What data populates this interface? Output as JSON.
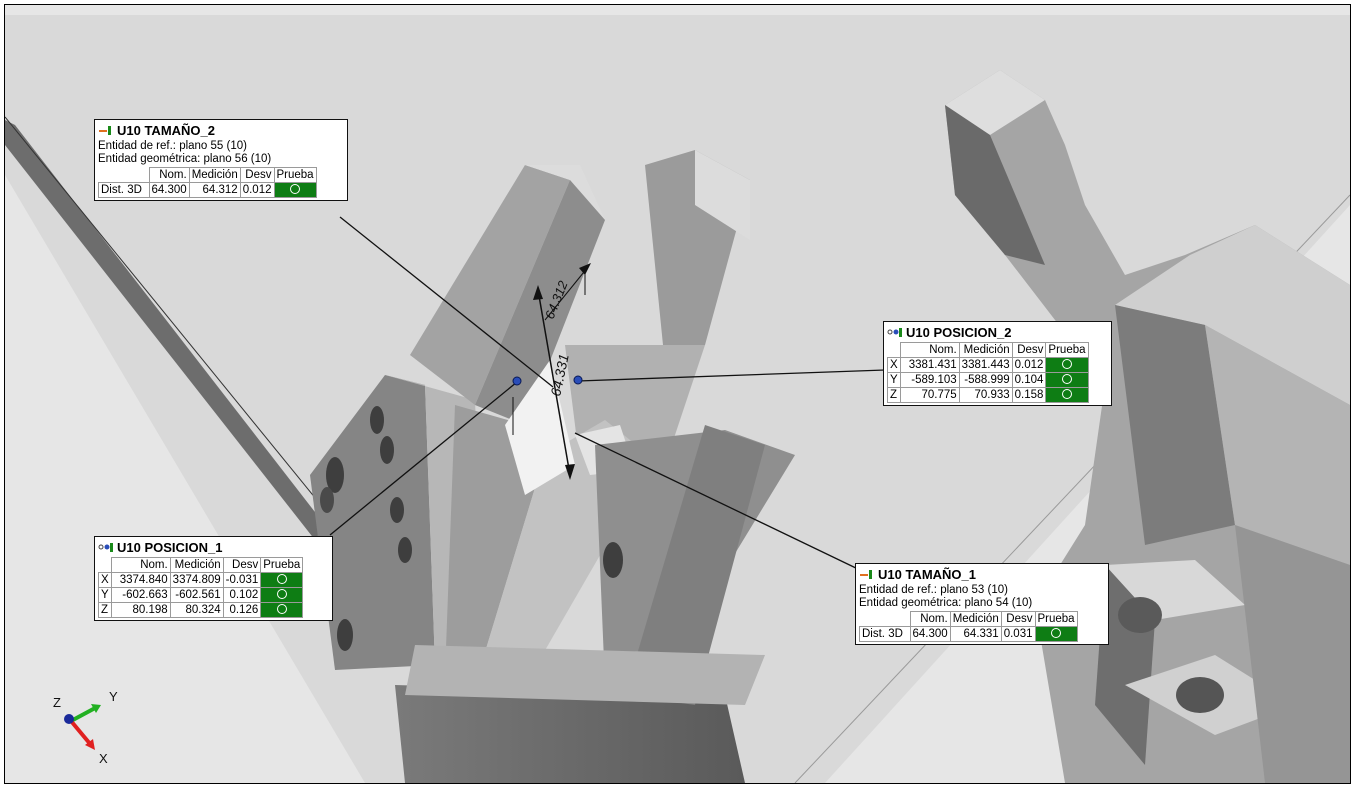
{
  "triad": {
    "x_label": "X",
    "y_label": "Y",
    "z_label": "Z"
  },
  "dimension_labels": {
    "d1": "64.331",
    "d2": "64.312"
  },
  "callouts": {
    "tamano2": {
      "title": "U10 TAMAÑO_2",
      "icon": "size-dimension-icon",
      "ref_line": "Entidad de ref.: plano 55 (10)",
      "geo_line": "Entidad geométrica: plano 56 (10)",
      "headers": [
        "Nom.",
        "Medición",
        "Desv",
        "Prueba"
      ],
      "row": {
        "label": "Dist. 3D",
        "nom": "64.300",
        "med": "64.312",
        "desv": "0.012"
      }
    },
    "tamano1": {
      "title": "U10 TAMAÑO_1",
      "icon": "size-dimension-icon",
      "ref_line": "Entidad de ref.: plano 53 (10)",
      "geo_line": "Entidad geométrica: plano 54 (10)",
      "headers": [
        "Nom.",
        "Medición",
        "Desv",
        "Prueba"
      ],
      "row": {
        "label": "Dist. 3D",
        "nom": "64.300",
        "med": "64.331",
        "desv": "0.031"
      }
    },
    "posicion1": {
      "title": "U10 POSICION_1",
      "icon": "position-point-icon",
      "headers": [
        "Nom.",
        "Medición",
        "Desv",
        "Prueba"
      ],
      "rows": [
        {
          "label": "X",
          "nom": "3374.840",
          "med": "3374.809",
          "desv": "-0.031"
        },
        {
          "label": "Y",
          "nom": "-602.663",
          "med": "-602.561",
          "desv": "0.102"
        },
        {
          "label": "Z",
          "nom": "80.198",
          "med": "80.324",
          "desv": "0.126"
        }
      ]
    },
    "posicion2": {
      "title": "U10 POSICION_2",
      "icon": "position-point-icon",
      "headers": [
        "Nom.",
        "Medición",
        "Desv",
        "Prueba"
      ],
      "rows": [
        {
          "label": "X",
          "nom": "3381.431",
          "med": "3381.443",
          "desv": "0.012"
        },
        {
          "label": "Y",
          "nom": "-589.103",
          "med": "-588.999",
          "desv": "0.104"
        },
        {
          "label": "Z",
          "nom": "70.775",
          "med": "70.933",
          "desv": "0.158"
        }
      ]
    }
  },
  "colors": {
    "pass": "#0e7d14",
    "background": "#e6e6e6",
    "axis_x": "#e02020",
    "axis_y": "#22b022",
    "axis_z": "#1a2a9a"
  }
}
